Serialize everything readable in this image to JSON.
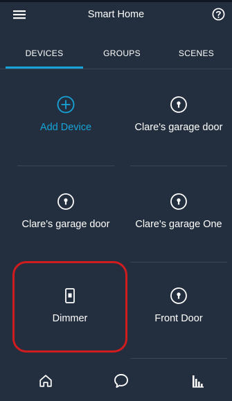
{
  "header": {
    "title": "Smart Home",
    "menu_icon": "hamburger-menu-icon",
    "help_icon": "question-circle-icon"
  },
  "tabs": [
    {
      "label": "DEVICES",
      "selected": true
    },
    {
      "label": "GROUPS",
      "selected": false
    },
    {
      "label": "SCENES",
      "selected": false
    }
  ],
  "devices": [
    {
      "label": "Add Device",
      "icon": "plus-circle-icon"
    },
    {
      "label": "Clare's garage door",
      "icon": "lock-icon"
    },
    {
      "label": "Clare's garage door",
      "icon": "lock-icon"
    },
    {
      "label": "Clare's garage One",
      "icon": "lock-icon"
    },
    {
      "label": "Dimmer",
      "icon": "switch-icon",
      "highlighted": true
    },
    {
      "label": "Front Door",
      "icon": "lock-icon"
    }
  ],
  "bottom_nav": [
    {
      "icon": "home-icon"
    },
    {
      "icon": "chat-bubble-icon"
    },
    {
      "icon": "activity-bars-icon"
    }
  ],
  "colors": {
    "background": "#232f3e",
    "accent": "#16a4d8",
    "highlight": "#d01c1f",
    "divider": "#3a4655"
  }
}
